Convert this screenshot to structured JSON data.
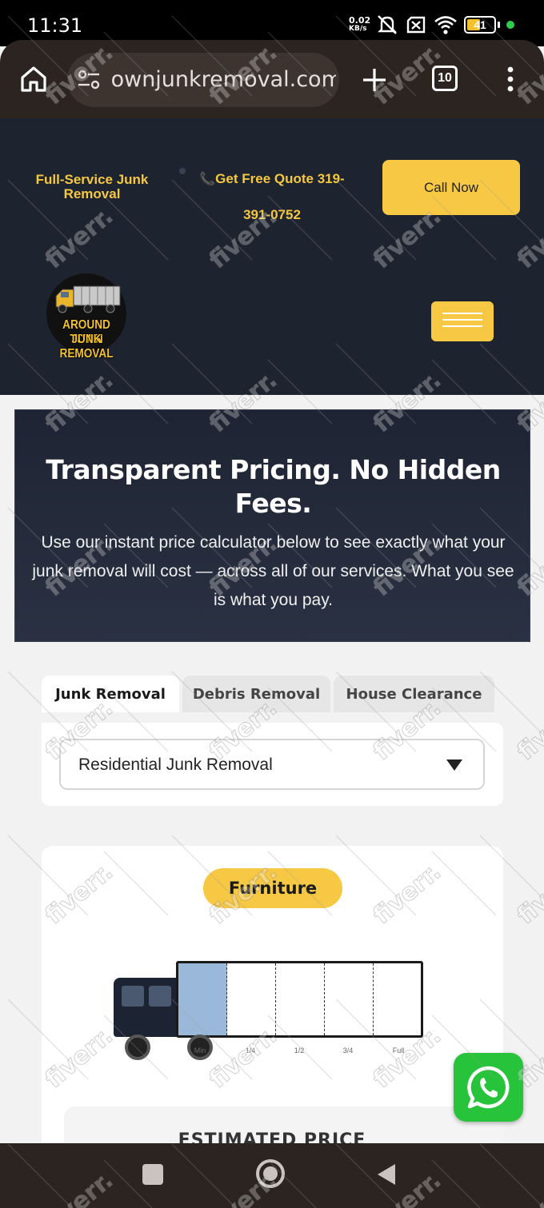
{
  "status_bar": {
    "time": "11:31",
    "net_speed_value": "0.02",
    "net_speed_unit": "KB/s",
    "battery": "41"
  },
  "browser": {
    "url": "townjunkremoval.com",
    "tab_count": "10"
  },
  "header": {
    "tagline": "Full-Service Junk Removal",
    "quote": "Get Free Quote 319-391-0752",
    "call_now": "Call Now",
    "logo_line1": "AROUND TOWN",
    "logo_line2": "JUNK REMOVAL"
  },
  "hero": {
    "title": "Transparent Pricing. No Hidden Fees.",
    "subtitle": "Use our instant price calculator below to see exactly what your junk removal will cost — across all of our services. What you see is what you pay."
  },
  "tabs": [
    {
      "label": "Junk Removal",
      "active": true
    },
    {
      "label": "Debris Removal",
      "active": false
    },
    {
      "label": "House Clearance",
      "active": false
    }
  ],
  "service_select": {
    "value": "Residential Junk Removal"
  },
  "calculator": {
    "category": "Furniture",
    "load_labels": [
      "Min",
      "1/4",
      "1/2",
      "3/4",
      "Full"
    ],
    "load_fill_fraction": 0.2,
    "estimate_label": "ESTIMATED PRICE"
  },
  "watermark": "fiverr."
}
